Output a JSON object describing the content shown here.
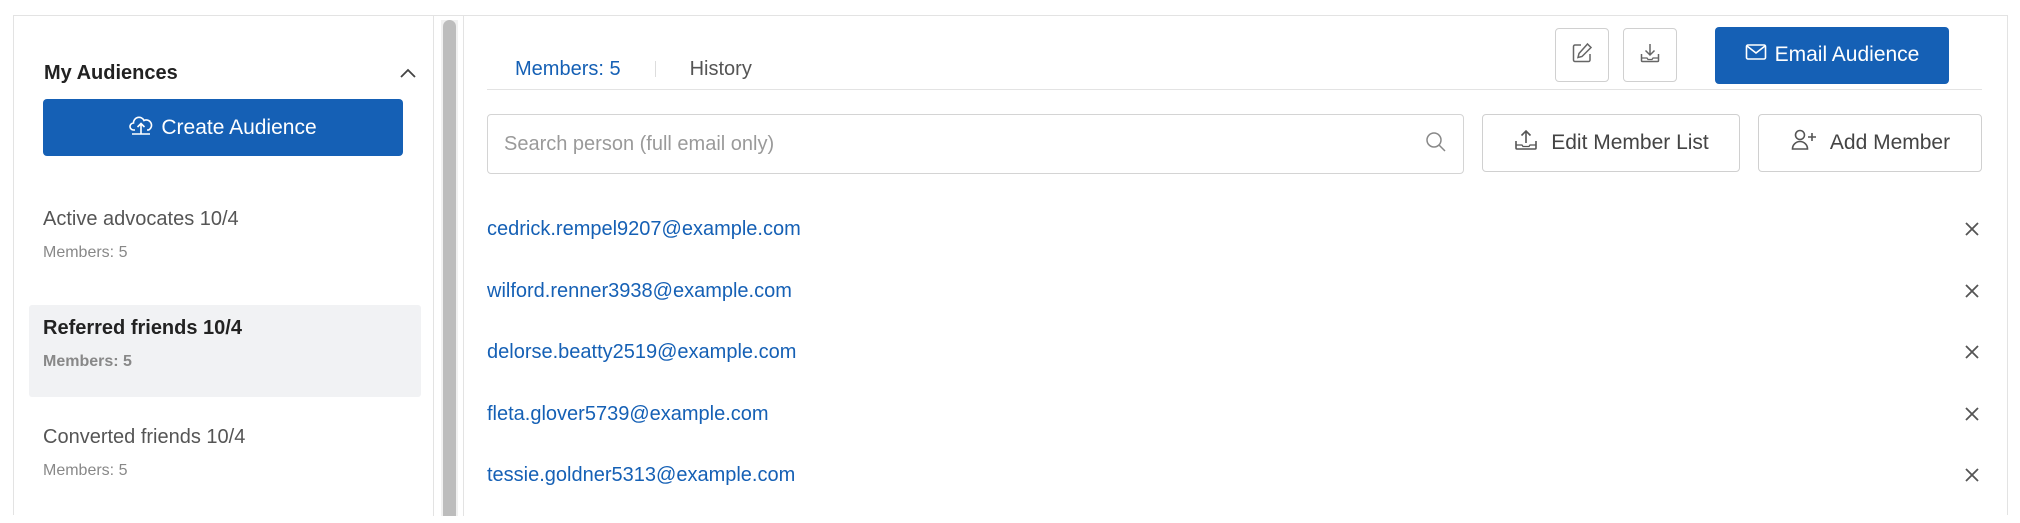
{
  "sidebar": {
    "title": "My Audiences",
    "create_button": "Create Audience",
    "audiences": [
      {
        "name": "Active advocates 10/4",
        "members": "Members: 5",
        "active": false
      },
      {
        "name": "Referred friends 10/4",
        "members": "Members: 5",
        "active": true
      },
      {
        "name": "Converted friends 10/4",
        "members": "Members: 5",
        "active": false
      }
    ]
  },
  "main": {
    "tabs": [
      {
        "label": "Members: 5",
        "active": true
      },
      {
        "label": "History",
        "active": false
      }
    ],
    "toolbar": {
      "edit_icon": "pencil-square-icon",
      "download_icon": "download-tray-icon",
      "email_button": "Email Audience"
    },
    "search": {
      "placeholder": "Search person (full email only)",
      "value": ""
    },
    "edit_member_list": "Edit Member List",
    "add_member": "Add Member",
    "members": [
      "cedrick.rempel9207@example.com",
      "wilford.renner3938@example.com",
      "delorse.beatty2519@example.com",
      "fleta.glover5739@example.com",
      "tessie.goldner5313@example.com"
    ]
  },
  "colors": {
    "accent": "#1560b5",
    "active_bg": "#f1f2f4",
    "border": "#d0d0d0"
  }
}
